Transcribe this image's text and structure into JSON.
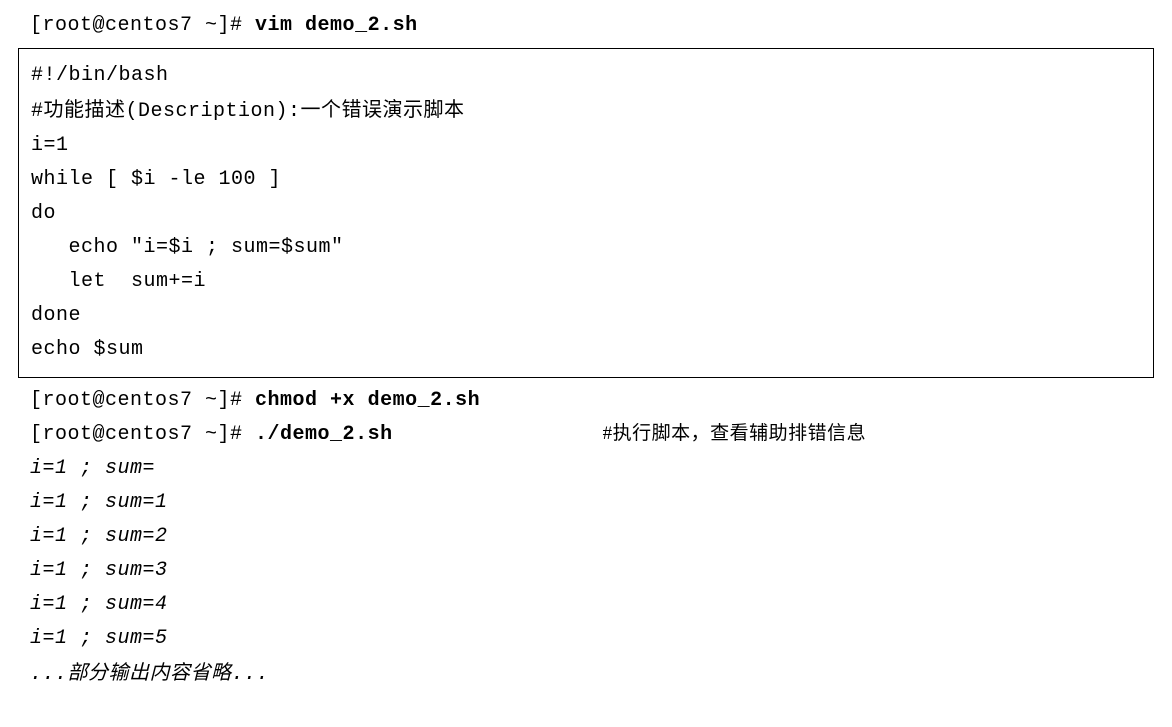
{
  "top_prompt": {
    "prefix": "[root@centos7 ~]# ",
    "command": "vim demo_2.sh"
  },
  "script": {
    "line1": "#!/bin/bash",
    "line2_prefix": "#",
    "line2_cn1": "功能描述",
    "line2_mid": "(Description):",
    "line2_cn2": "一个错误演示脚本",
    "blank": "",
    "line4": "i=1",
    "line5": "while [ $i -le 100 ]",
    "line6": "do",
    "line7": "   echo \"i=$i ; sum=$sum\"",
    "line8": "   let  sum+=i",
    "line9": "done",
    "line10": "echo $sum"
  },
  "cmd_chmod": {
    "prefix": "[root@centos7 ~]# ",
    "command": "chmod +x demo_2.sh"
  },
  "cmd_run": {
    "prefix": "[root@centos7 ~]# ",
    "command": "./demo_2.sh",
    "comment": "#执行脚本，查看辅助排错信息"
  },
  "output": [
    "i=1 ; sum=",
    "i=1 ; sum=1",
    "i=1 ; sum=2",
    "i=1 ; sum=3",
    "i=1 ; sum=4",
    "i=1 ; sum=5"
  ],
  "ellipsis": {
    "dots1": "...",
    "cn": "部分输出内容省略",
    "dots2": "..."
  }
}
